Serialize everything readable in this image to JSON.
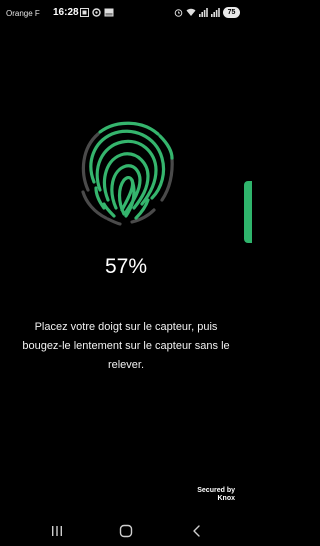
{
  "status_bar": {
    "carrier": "Orange F",
    "time": "16:28",
    "battery": "75",
    "left_icons": [
      "screenshot-icon",
      "settings-status-icon",
      "gallery-icon"
    ],
    "right_icons": [
      "alarm-icon",
      "wifi-icon",
      "signal-icon",
      "signal-icon"
    ]
  },
  "fingerprint": {
    "progress_percent": 57,
    "filled_color": "#35b56d",
    "empty_color": "#4a4a4a"
  },
  "progress_label": "57%",
  "instruction": "Placez votre doigt sur le capteur, puis bougez-le lentement sur le capteur sans le relever.",
  "footer": {
    "secured_line1": "Secured by",
    "secured_line2": "Knox"
  },
  "nav": {
    "buttons": [
      "recents",
      "home",
      "back"
    ]
  },
  "colors": {
    "background": "#000000",
    "accent": "#2fb46c",
    "text": "#ffffff"
  }
}
